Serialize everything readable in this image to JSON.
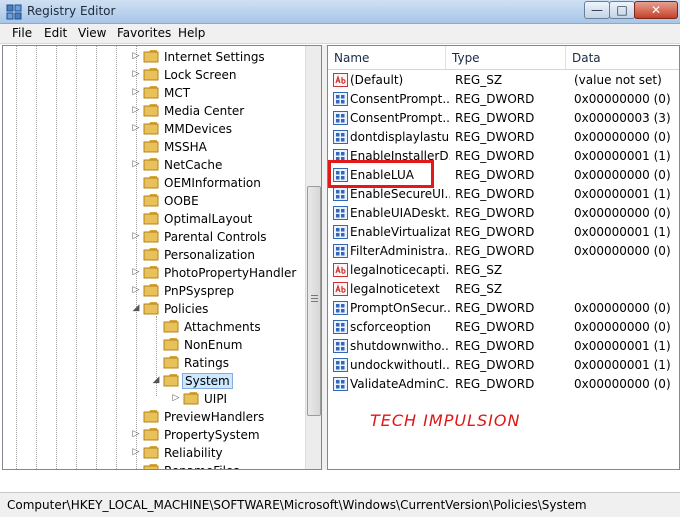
{
  "window": {
    "title": "Registry Editor",
    "minimize": "—",
    "maximize": "□",
    "close": "✕"
  },
  "menu": {
    "file": "File",
    "edit": "Edit",
    "view": "View",
    "favorites": "Favorites",
    "help": "Help"
  },
  "tree": {
    "items": [
      {
        "label": "Internet Settings",
        "expander": "▷"
      },
      {
        "label": "Lock Screen",
        "expander": "▷"
      },
      {
        "label": "MCT",
        "expander": "▷"
      },
      {
        "label": "Media Center",
        "expander": "▷"
      },
      {
        "label": "MMDevices",
        "expander": "▷"
      },
      {
        "label": "MSSHA",
        "expander": ""
      },
      {
        "label": "NetCache",
        "expander": "▷"
      },
      {
        "label": "OEMInformation",
        "expander": ""
      },
      {
        "label": "OOBE",
        "expander": ""
      },
      {
        "label": "OptimalLayout",
        "expander": ""
      },
      {
        "label": "Parental Controls",
        "expander": "▷"
      },
      {
        "label": "Personalization",
        "expander": ""
      },
      {
        "label": "PhotoPropertyHandler",
        "expander": "▷"
      },
      {
        "label": "PnPSysprep",
        "expander": "▷"
      },
      {
        "label": "Policies",
        "expander": "◢"
      },
      {
        "label": "Attachments",
        "expander": ""
      },
      {
        "label": "NonEnum",
        "expander": ""
      },
      {
        "label": "Ratings",
        "expander": ""
      },
      {
        "label": "System",
        "expander": "◢"
      },
      {
        "label": "UIPI",
        "expander": "▷"
      },
      {
        "label": "PreviewHandlers",
        "expander": ""
      },
      {
        "label": "PropertySystem",
        "expander": "▷"
      },
      {
        "label": "Reliability",
        "expander": "▷"
      },
      {
        "label": "RenameFiles",
        "expander": ""
      }
    ]
  },
  "list": {
    "columns": {
      "name": "Name",
      "type": "Type",
      "data": "Data"
    },
    "rows": [
      {
        "name": "(Default)",
        "type": "REG_SZ",
        "data": "(value not set)",
        "icon": "string-value-icon"
      },
      {
        "name": "ConsentPrompt...",
        "type": "REG_DWORD",
        "data": "0x00000000 (0)",
        "icon": "dword-value-icon"
      },
      {
        "name": "ConsentPrompt...",
        "type": "REG_DWORD",
        "data": "0x00000003 (3)",
        "icon": "dword-value-icon"
      },
      {
        "name": "dontdisplaylastu...",
        "type": "REG_DWORD",
        "data": "0x00000000 (0)",
        "icon": "dword-value-icon"
      },
      {
        "name": "EnableInstallerD...",
        "type": "REG_DWORD",
        "data": "0x00000001 (1)",
        "icon": "dword-value-icon"
      },
      {
        "name": "EnableLUA",
        "type": "REG_DWORD",
        "data": "0x00000000 (0)",
        "icon": "dword-value-icon"
      },
      {
        "name": "EnableSecureUI...",
        "type": "REG_DWORD",
        "data": "0x00000001 (1)",
        "icon": "dword-value-icon"
      },
      {
        "name": "EnableUIADeskt...",
        "type": "REG_DWORD",
        "data": "0x00000000 (0)",
        "icon": "dword-value-icon"
      },
      {
        "name": "EnableVirtualizat...",
        "type": "REG_DWORD",
        "data": "0x00000001 (1)",
        "icon": "dword-value-icon"
      },
      {
        "name": "FilterAdministra...",
        "type": "REG_DWORD",
        "data": "0x00000000 (0)",
        "icon": "dword-value-icon"
      },
      {
        "name": "legalnoticecapti...",
        "type": "REG_SZ",
        "data": "",
        "icon": "string-value-icon"
      },
      {
        "name": "legalnoticetext",
        "type": "REG_SZ",
        "data": "",
        "icon": "string-value-icon"
      },
      {
        "name": "PromptOnSecur...",
        "type": "REG_DWORD",
        "data": "0x00000000 (0)",
        "icon": "dword-value-icon"
      },
      {
        "name": "scforceoption",
        "type": "REG_DWORD",
        "data": "0x00000000 (0)",
        "icon": "dword-value-icon"
      },
      {
        "name": "shutdownwitho...",
        "type": "REG_DWORD",
        "data": "0x00000001 (1)",
        "icon": "dword-value-icon"
      },
      {
        "name": "undockwithoutl...",
        "type": "REG_DWORD",
        "data": "0x00000001 (1)",
        "icon": "dword-value-icon"
      },
      {
        "name": "ValidateAdminC...",
        "type": "REG_DWORD",
        "data": "0x00000000 (0)",
        "icon": "dword-value-icon"
      }
    ]
  },
  "watermark": "TECH IMPULSION",
  "status": {
    "path": "Computer\\HKEY_LOCAL_MACHINE\\SOFTWARE\\Microsoft\\Windows\\CurrentVersion\\Policies\\System"
  },
  "colors": {
    "highlight_box": "#e31919",
    "watermark": "#e01616",
    "folder": "#e8c15a",
    "selection": "#cde8ff"
  }
}
